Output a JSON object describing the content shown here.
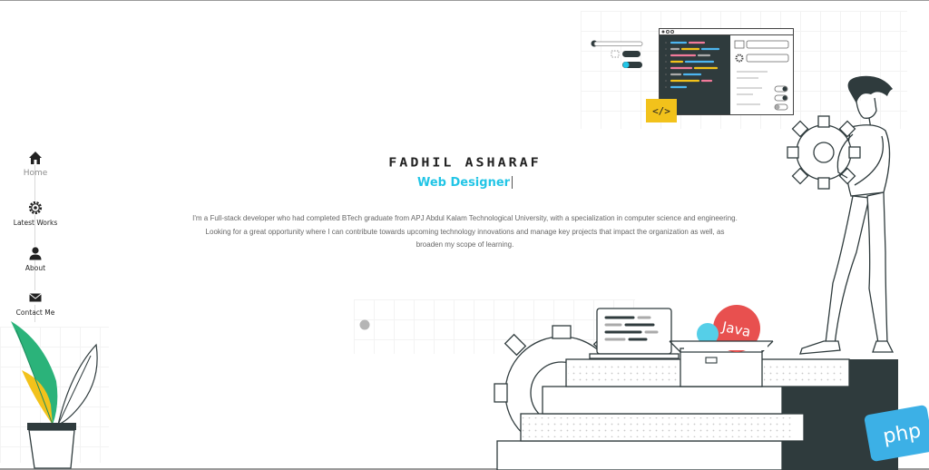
{
  "nav": {
    "items": [
      {
        "label": "Home",
        "icon": "home-icon"
      },
      {
        "label": "Latest Works",
        "icon": "gear-icon"
      },
      {
        "label": "About",
        "icon": "user-icon"
      },
      {
        "label": "Contact Me",
        "icon": "envelope-icon"
      }
    ]
  },
  "profile": {
    "name": "FADHIL ASHARAF",
    "role": "Web Designer",
    "bio_line_1": "I'm a Full-stack developer who had completed BTech graduate from APJ Abdul Kalam Technological University, with a specialization in computer science and engineering.",
    "bio_line_2": "Looking for a great opportunity where I can contribute towards upcoming technology innovations and manage key projects that impact the organization as well, as",
    "bio_line_3": "broaden my scope of learning."
  },
  "illustration": {
    "code_tag": "</>",
    "java_label": "Java",
    "php_label": "php"
  },
  "colors": {
    "accent": "#22c5e6",
    "dark": "#2f3b3d",
    "yellow": "#f2c21b",
    "java_red": "#e8504f",
    "php_blue": "#3cb0e6",
    "leaf_green": "#2bb37a"
  }
}
